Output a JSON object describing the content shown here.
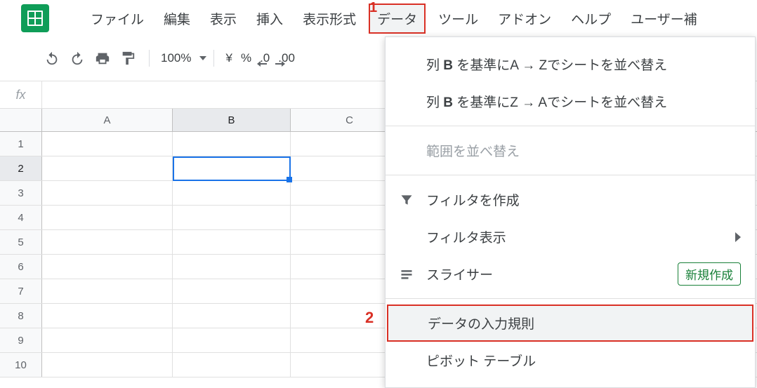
{
  "menubar": {
    "items": [
      "ファイル",
      "編集",
      "表示",
      "挿入",
      "表示形式",
      "データ",
      "ツール",
      "アドオン",
      "ヘルプ",
      "ユーザー補"
    ],
    "open_index": 5
  },
  "callouts": {
    "one": "1",
    "two": "2"
  },
  "toolbar": {
    "zoom": "100%",
    "currency": "¥",
    "percent": "%",
    "dec_less": ".0",
    "dec_more": ".00"
  },
  "formula_bar": {
    "fx": "fx",
    "value": ""
  },
  "grid": {
    "columns": [
      "A",
      "B",
      "C"
    ],
    "rows": [
      "1",
      "2",
      "3",
      "4",
      "5",
      "6",
      "7",
      "8",
      "9",
      "10"
    ],
    "selected_cell": "B2"
  },
  "dropdown": {
    "sort_az_prefix": "列 ",
    "sort_az_col": "B",
    "sort_az_mid": " を基準にA → Zでシートを並べ替え",
    "sort_za_prefix": "列 ",
    "sort_za_col": "B",
    "sort_za_mid": " を基準にZ → Aでシートを並べ替え",
    "sort_range": "範囲を並べ替え",
    "create_filter": "フィルタを作成",
    "filter_views": "フィルタ表示",
    "slicer": "スライサー",
    "slicer_badge": "新規作成",
    "data_validation": "データの入力規則",
    "pivot_table": "ピボット テーブル"
  }
}
